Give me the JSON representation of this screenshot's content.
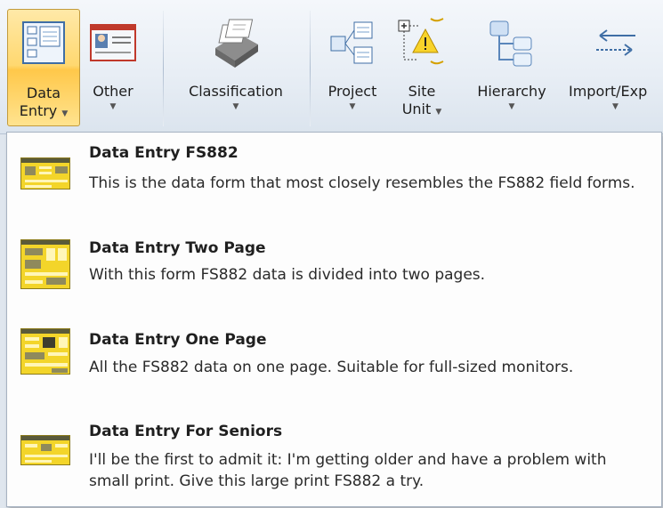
{
  "ribbon": {
    "data_entry": {
      "line1": "Data",
      "line2": "Entry"
    },
    "other": {
      "label": "Other"
    },
    "classification": {
      "label": "Classification"
    },
    "project": {
      "label": "Project"
    },
    "site_unit": {
      "line1": "Site",
      "line2": "Unit"
    },
    "hierarchy": {
      "label": "Hierarchy"
    },
    "import_export": {
      "label": "Import/Exp"
    },
    "caret": "▼"
  },
  "menu": {
    "items": [
      {
        "title": "Data Entry FS882",
        "description": "This is the data form that most closely resembles the FS882 field forms."
      },
      {
        "title": "Data Entry Two Page",
        "description": "With this form FS882 data is divided into two pages."
      },
      {
        "title": "Data Entry One Page",
        "description": "All the FS882 data on one page.  Suitable for full-sized monitors."
      },
      {
        "title": "Data Entry For Seniors",
        "description": "I'll be the first to admit it: I'm getting older and have a problem with small print.  Give this large print FS882 a try."
      }
    ]
  },
  "colors": {
    "active_button": "#ffd870",
    "thumbnail_yellow": "#f3d52a",
    "menu_background": "#fdfdfd"
  }
}
